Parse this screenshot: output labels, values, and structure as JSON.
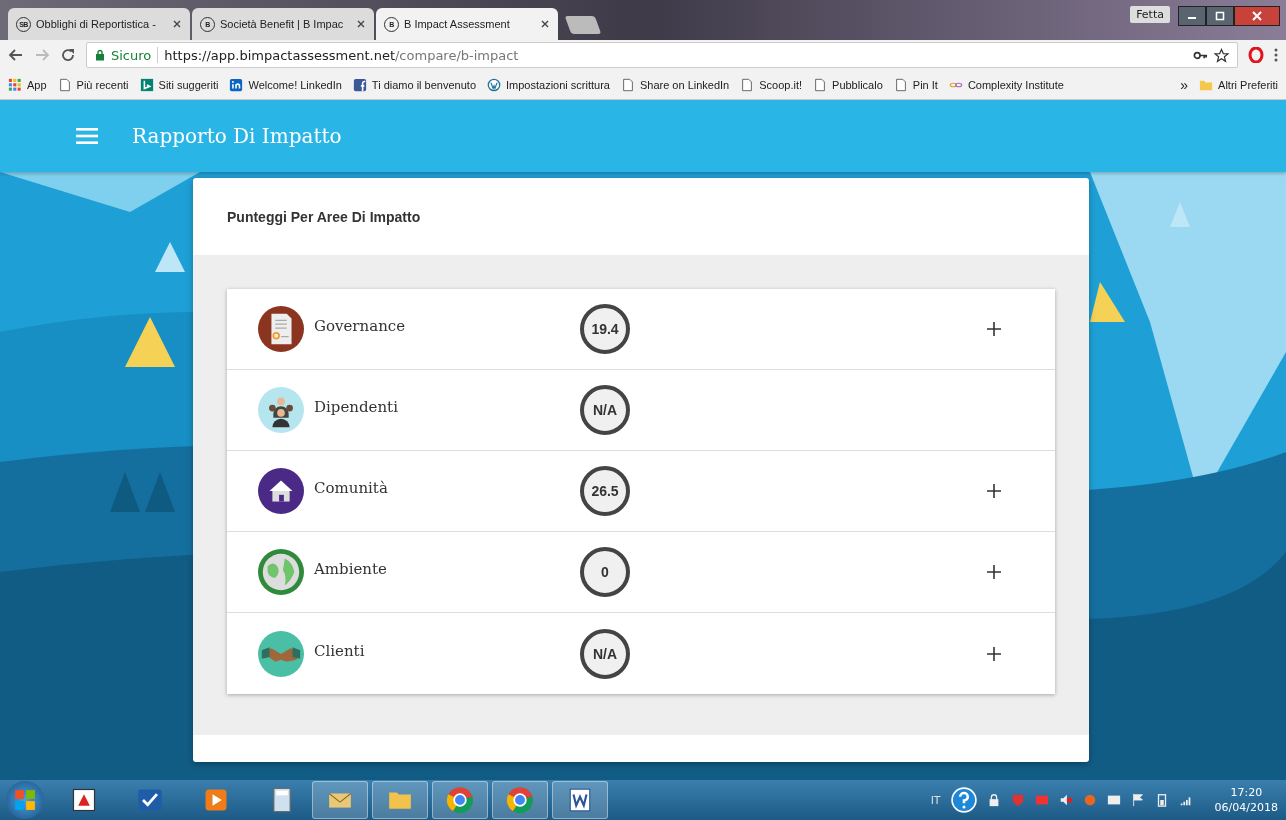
{
  "browser": {
    "tabs": [
      {
        "title": "Obblighi di Reportistica -",
        "favicon": "SB",
        "selected": false
      },
      {
        "title": "Società Benefit | B Impac",
        "favicon": "B",
        "selected": false
      },
      {
        "title": "B Impact Assessment",
        "favicon": "B",
        "selected": true
      }
    ],
    "profile": "Fetta",
    "security": "Sicuro",
    "url_host": "https://app.bimpactassessment.net",
    "url_path": "/compare/b-impact",
    "bookmarks": [
      {
        "label": "App",
        "kind": "apps"
      },
      {
        "label": "Più recenti",
        "kind": "page"
      },
      {
        "label": "Siti suggeriti",
        "kind": "bing"
      },
      {
        "label": "Welcome!  LinkedIn",
        "kind": "linkedin"
      },
      {
        "label": "Ti diamo il benvenuto",
        "kind": "facebook"
      },
      {
        "label": "Impostazioni scrittura",
        "kind": "wordpress"
      },
      {
        "label": "Share on LinkedIn",
        "kind": "page"
      },
      {
        "label": "Scoop.it!",
        "kind": "page"
      },
      {
        "label": "Pubblicalo",
        "kind": "page"
      },
      {
        "label": "Pin It",
        "kind": "page"
      },
      {
        "label": "Complexity Institute",
        "kind": "chain"
      }
    ],
    "bookmarks_overflow": "»",
    "other_bookmarks": "Altri Preferiti"
  },
  "app": {
    "title": "Rapporto Di Impatto",
    "card_title": "Punteggi Per Aree Di Impatto",
    "areas": [
      {
        "name": "Governance",
        "score": "19.4",
        "kind": "document",
        "color": "#8b3520",
        "expandable": true
      },
      {
        "name": "Dipendenti",
        "score": "N/A",
        "kind": "people",
        "color": "#b5e6f0",
        "expandable": false
      },
      {
        "name": "Comunità",
        "score": "26.5",
        "kind": "house",
        "color": "#4a2a86",
        "expandable": true
      },
      {
        "name": "Ambiente",
        "score": "0",
        "kind": "globe",
        "color": "#2f8a3c",
        "expandable": true
      },
      {
        "name": "Clienti",
        "score": "N/A",
        "kind": "handshake",
        "color": "#4bbfa6",
        "expandable": true
      }
    ]
  },
  "taskbar": {
    "language": "IT",
    "time": "17:20",
    "date": "06/04/2018"
  }
}
